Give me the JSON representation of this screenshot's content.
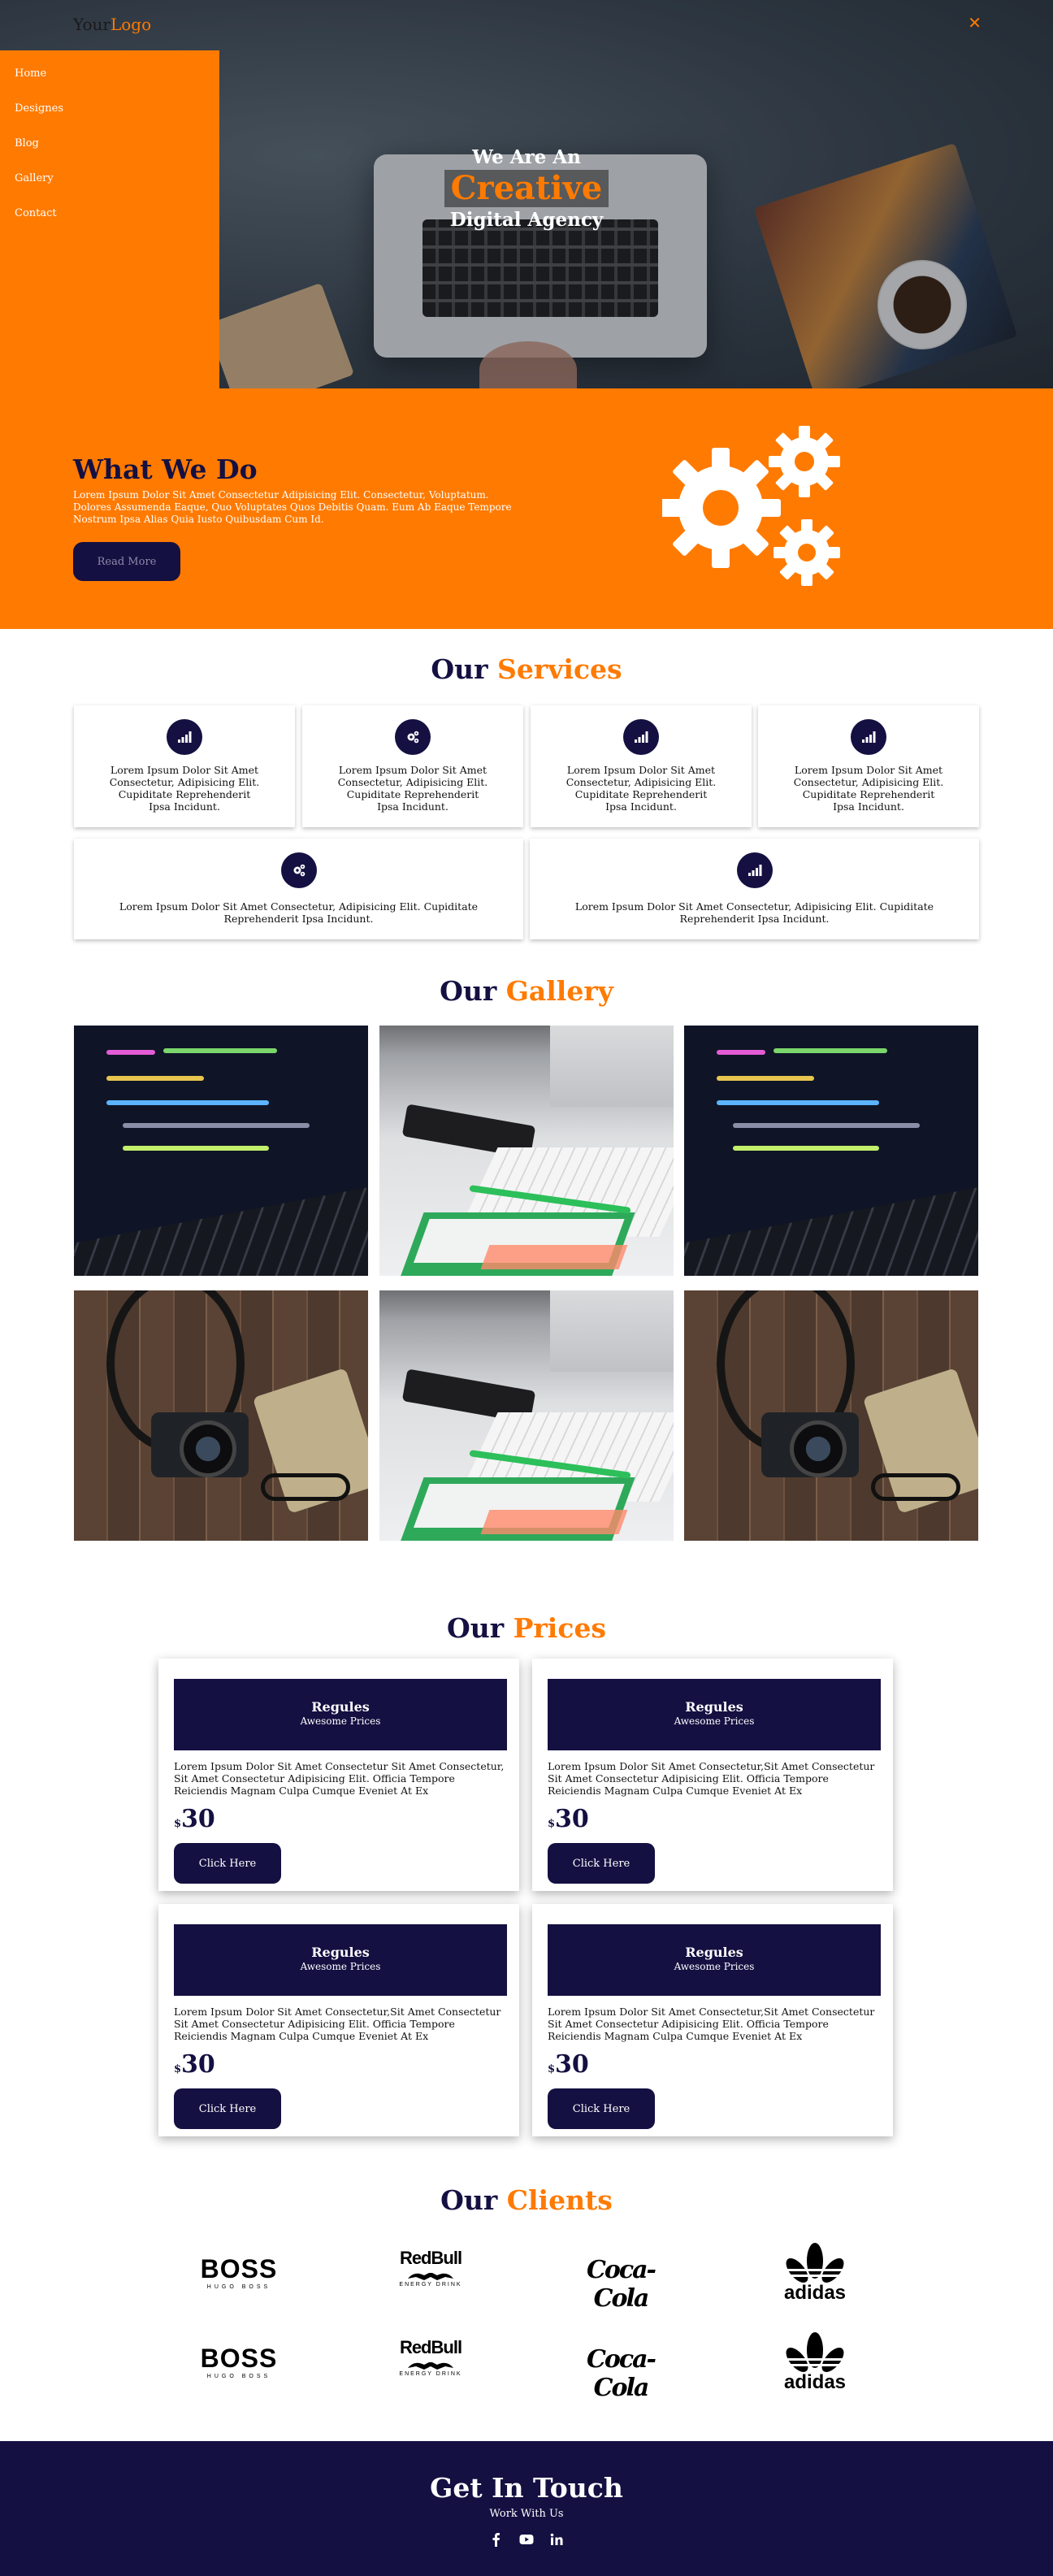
{
  "header": {
    "logo_part1": "Your",
    "logo_part2": "Logo",
    "close_symbol": "✕",
    "menu": [
      "Home",
      "Designes",
      "Blog",
      "Gallery",
      "Contact"
    ]
  },
  "hero": {
    "line1": "We Are An",
    "highlight": "Creative",
    "line3": "Digital Agency"
  },
  "what_we_do": {
    "title": "What We Do",
    "text": "Lorem Ipsum Dolor Sit Amet Consectetur Adipisicing Elit. Consectetur, Voluptatum. Dolores Assumenda Eaque, Quo Voluptates Quos Debitis Quam. Eum Ab Eaque Tempore Nostrum Ipsa Alias Quia Iusto Quibusdam Cum Id.",
    "button": "Read More",
    "icon": "gears-icon"
  },
  "services": {
    "title_part1": "Our",
    "title_part2": "Services",
    "cards": [
      {
        "icon": "signal-icon",
        "text": "Lorem Ipsum Dolor Sit Amet Consectetur, Adipisicing Elit. Cupiditate Reprehenderit Ipsa Incidunt."
      },
      {
        "icon": "cogs-icon",
        "text": "Lorem Ipsum Dolor Sit Amet Consectetur, Adipisicing Elit. Cupiditate Reprehenderit Ipsa Incidunt."
      },
      {
        "icon": "signal-icon",
        "text": "Lorem Ipsum Dolor Sit Amet Consectetur, Adipisicing Elit. Cupiditate Reprehenderit Ipsa Incidunt."
      },
      {
        "icon": "signal-icon",
        "text": "Lorem Ipsum Dolor Sit Amet Consectetur, Adipisicing Elit. Cupiditate Reprehenderit Ipsa Incidunt."
      },
      {
        "icon": "cogs-icon",
        "text": "Lorem Ipsum Dolor Sit Amet Consectetur, Adipisicing Elit. Cupiditate Reprehenderit Ipsa Incidunt."
      },
      {
        "icon": "signal-icon",
        "text": "Lorem Ipsum Dolor Sit Amet Consectetur, Adipisicing Elit. Cupiditate Reprehenderit Ipsa Incidunt."
      }
    ]
  },
  "gallery": {
    "title_part1": "Our",
    "title_part2": "Gallery",
    "images": [
      "code-on-laptop-photo",
      "keyboard-desk-photo",
      "code-on-laptop-photo",
      "camera-glasses-photo",
      "keyboard-desk-photo",
      "camera-glasses-photo"
    ]
  },
  "prices": {
    "title_part1": "Our",
    "title_part2": "Prices",
    "plans": [
      {
        "title": "Regules",
        "subtitle": "Awesome Prices",
        "text": "Lorem Ipsum Dolor Sit Amet Consectetur Sit Amet Consectetur, Sit Amet Consectetur Adipisicing Elit. Officia Tempore Reiciendis Magnam Culpa Cumque Eveniet At Ex",
        "currency": "$",
        "amount": "30",
        "button": "Click Here"
      },
      {
        "title": "Regules",
        "subtitle": "Awesome Prices",
        "text": "Lorem Ipsum Dolor Sit Amet Consectetur,Sit Amet Consectetur Sit Amet Consectetur Adipisicing Elit. Officia Tempore Reiciendis Magnam Culpa Cumque Eveniet At Ex",
        "currency": "$",
        "amount": "30",
        "button": "Click Here"
      },
      {
        "title": "Regules",
        "subtitle": "Awesome Prices",
        "text": "Lorem Ipsum Dolor Sit Amet Consectetur,Sit Amet Consectetur Sit Amet Consectetur Adipisicing Elit. Officia Tempore Reiciendis Magnam Culpa Cumque Eveniet At Ex",
        "currency": "$",
        "amount": "30",
        "button": "Click Here"
      },
      {
        "title": "Regules",
        "subtitle": "Awesome Prices",
        "text": "Lorem Ipsum Dolor Sit Amet Consectetur,Sit Amet Consectetur Sit Amet Consectetur Adipisicing Elit. Officia Tempore Reiciendis Magnam Culpa Cumque Eveniet At Ex",
        "currency": "$",
        "amount": "30",
        "button": "Click Here"
      }
    ]
  },
  "clients": {
    "title_part1": "Our",
    "title_part2": "Clients",
    "boss": {
      "main": "BOSS",
      "sub": "HUGO BOSS"
    },
    "redbull": {
      "main": "RedBull",
      "sub": "ENERGY DRINK"
    },
    "cocacola": {
      "main": "Coca-Cola"
    },
    "adidas": {
      "main": "adidas"
    }
  },
  "footer": {
    "title": "Get In Touch",
    "subtitle": "Work With Us",
    "socials": [
      "facebook-icon",
      "youtube-icon",
      "linkedin-icon"
    ]
  },
  "colors": {
    "accent": "#ff7a00",
    "navy": "#141042"
  }
}
